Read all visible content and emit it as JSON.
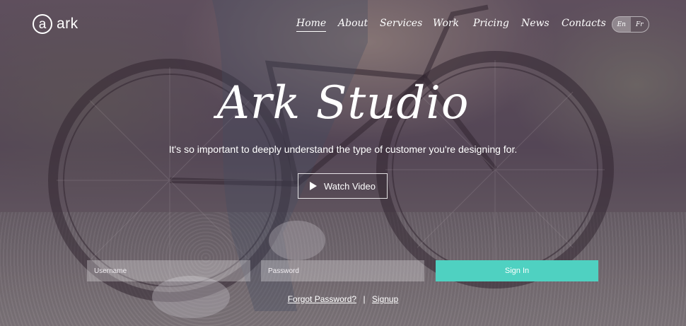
{
  "logo": {
    "badge": "a",
    "name": "ark"
  },
  "nav": {
    "items": [
      {
        "label": "Home",
        "active": true
      },
      {
        "label": "About"
      },
      {
        "label": "Services"
      },
      {
        "label": "Work"
      },
      {
        "label": "Pricing"
      },
      {
        "label": "News"
      },
      {
        "label": "Contacts"
      }
    ]
  },
  "language": {
    "options": [
      "En",
      "Fr"
    ],
    "selected": "En"
  },
  "hero": {
    "title": "Ark Studio",
    "subtitle": "It's so important to deeply understand the type of customer you're designing for.",
    "watch_label": "Watch Video",
    "watch_icon": "play-icon"
  },
  "login": {
    "username_placeholder": "Username",
    "password_placeholder": "Password",
    "signin_label": "Sign In"
  },
  "links": {
    "forgot": "Forgot Password?",
    "separator": "|",
    "signup": "Signup"
  },
  "colors": {
    "accent": "#4fd1c1",
    "overlay": "#46374b"
  }
}
